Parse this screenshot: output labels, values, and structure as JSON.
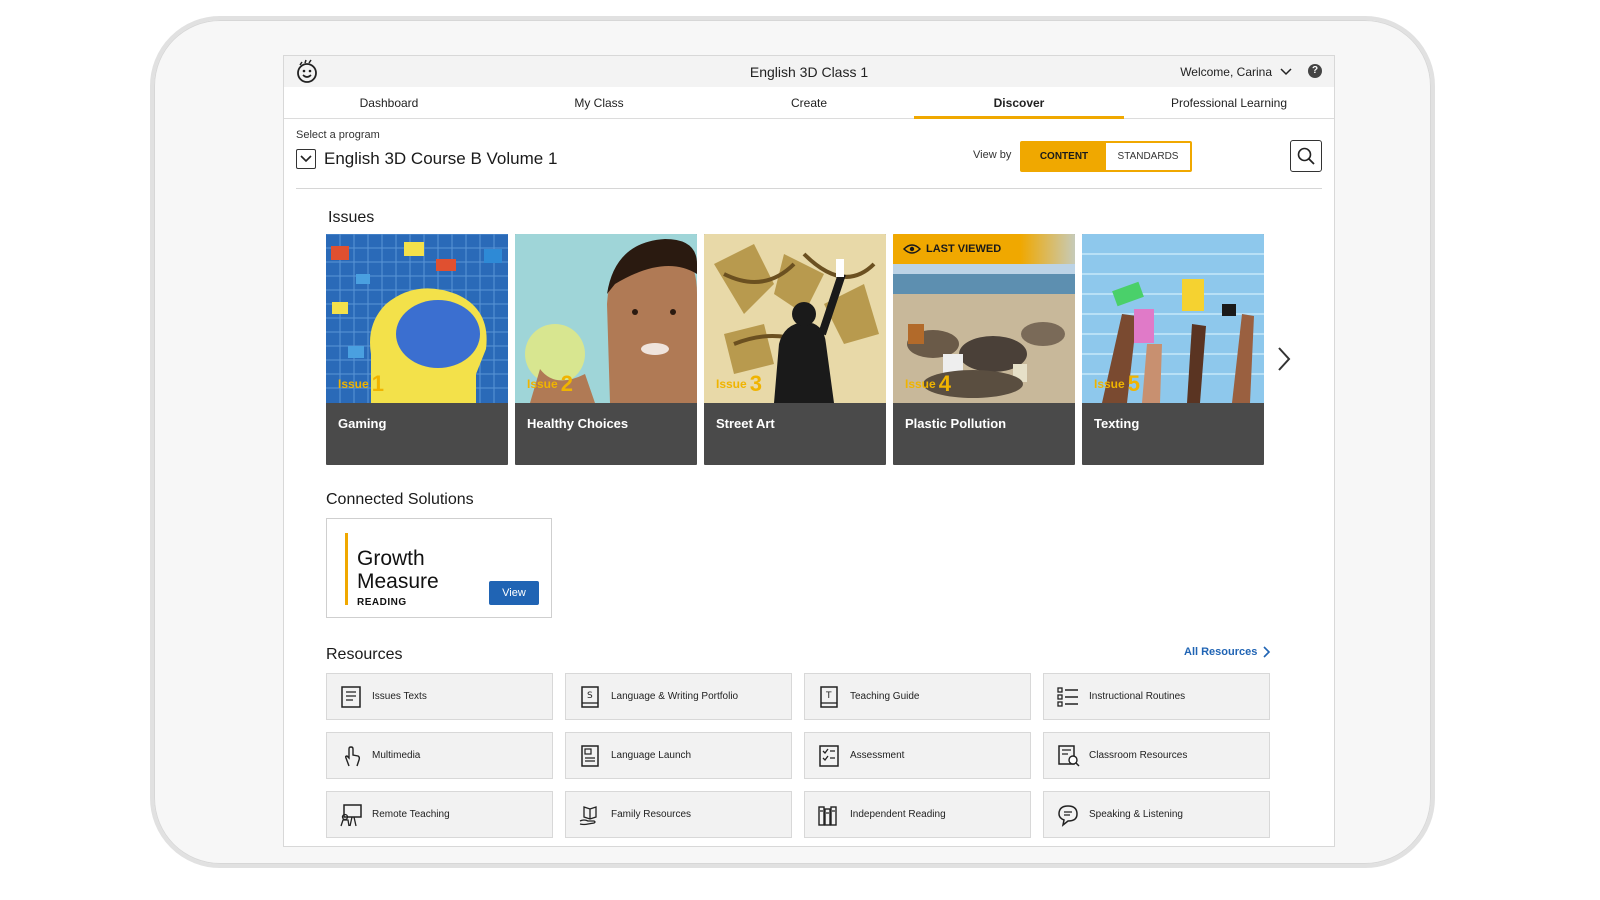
{
  "header": {
    "class_title": "English 3D Class 1",
    "welcome": "Welcome, Carina",
    "help_glyph": "?"
  },
  "nav": [
    {
      "label": "Dashboard",
      "active": false
    },
    {
      "label": "My Class",
      "active": false
    },
    {
      "label": "Create",
      "active": false
    },
    {
      "label": "Discover",
      "active": true
    },
    {
      "label": "Professional Learning",
      "active": false
    }
  ],
  "program": {
    "select_label": "Select a program",
    "name": "English 3D Course B Volume 1",
    "view_by_label": "View by",
    "toggle": {
      "content": "CONTENT",
      "standards": "STANDARDS",
      "selected": "content"
    }
  },
  "issues": {
    "title": "Issues",
    "items": [
      {
        "prefix": "Issue",
        "number": "1",
        "title": "Gaming"
      },
      {
        "prefix": "Issue",
        "number": "2",
        "title": "Healthy Choices"
      },
      {
        "prefix": "Issue",
        "number": "3",
        "title": "Street Art"
      },
      {
        "prefix": "Issue",
        "number": "4",
        "title": "Plastic Pollution",
        "badge": "LAST VIEWED"
      },
      {
        "prefix": "Issue",
        "number": "5",
        "title": "Texting"
      }
    ]
  },
  "connected": {
    "title": "Connected Solutions",
    "card_title_line1": "Growth",
    "card_title_line2": "Measure",
    "card_subtitle": "READING",
    "view_label": "View"
  },
  "resources": {
    "title": "Resources",
    "all_label": "All Resources",
    "items": [
      {
        "label": "Issues Texts",
        "icon": "book-icon"
      },
      {
        "label": "Language & Writing Portfolio",
        "icon": "portfolio-icon"
      },
      {
        "label": "Teaching Guide",
        "icon": "teaching-guide-icon"
      },
      {
        "label": "Instructional Routines",
        "icon": "list-icon"
      },
      {
        "label": "Multimedia",
        "icon": "touch-icon"
      },
      {
        "label": "Language Launch",
        "icon": "document-icon"
      },
      {
        "label": "Assessment",
        "icon": "checklist-icon"
      },
      {
        "label": "Classroom Resources",
        "icon": "search-document-icon"
      },
      {
        "label": "Remote Teaching",
        "icon": "presentation-icon"
      },
      {
        "label": "Family Resources",
        "icon": "hand-book-icon"
      },
      {
        "label": "Independent Reading",
        "icon": "books-icon"
      },
      {
        "label": "Speaking & Listening",
        "icon": "speech-bubble-icon"
      }
    ]
  },
  "colors": {
    "accent": "#f0a800",
    "link": "#2064b4",
    "card_bg": "#4a4a4a"
  }
}
